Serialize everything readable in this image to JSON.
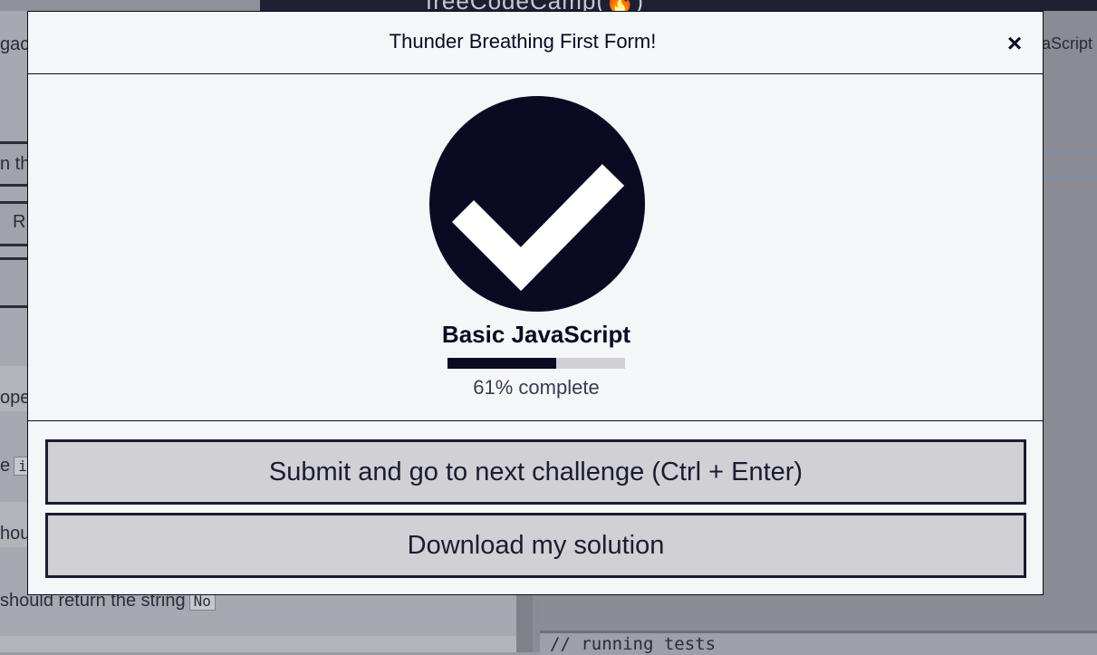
{
  "background": {
    "logo_text": "freeCodeCamp(🔥)",
    "left_snippets": [
      "gacy",
      "n th",
      "R",
      "ope",
      "e",
      "hou",
      "should return the string"
    ],
    "code_chip_1": "i",
    "code_chip_2": "No",
    "right_tab": "aScript",
    "console_text": "// running tests"
  },
  "modal": {
    "title": "Thunder Breathing First Form!",
    "close_label": "×",
    "check_icon": "checkmark-circle-icon",
    "block_title": "Basic JavaScript",
    "progress_percent": 61,
    "progress_text": "61% complete",
    "buttons": {
      "submit": "Submit and go to next challenge (Ctrl + Enter)",
      "download": "Download my solution"
    }
  },
  "colors": {
    "primary": "#0a0a23",
    "button_bg": "#d0d0d5",
    "modal_bg": "#f5f6f7"
  }
}
